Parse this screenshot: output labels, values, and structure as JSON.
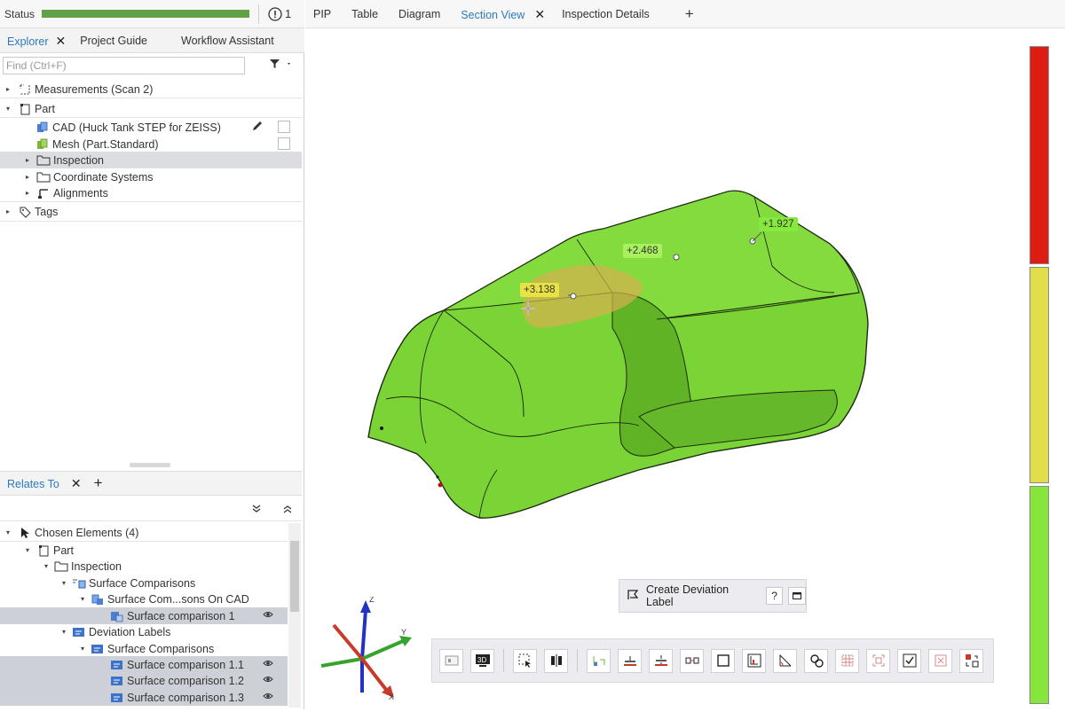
{
  "status": {
    "label": "Status",
    "progress": 1.0,
    "warning_count": "1"
  },
  "explorer": {
    "tabs": [
      {
        "label": "Explorer",
        "close": "✕"
      },
      {
        "label": "Project Guide"
      },
      {
        "label": "Workflow Assistant"
      }
    ],
    "find_placeholder": "Find (Ctrl+F)",
    "filter_icon": "filter-icon",
    "tree": [
      {
        "label": "Measurements (Scan 2)"
      },
      {
        "label": "Part"
      },
      {
        "label": "CAD (Huck Tank STEP for ZEISS)"
      },
      {
        "label": "Mesh (Part.Standard)"
      },
      {
        "label": "Inspection"
      },
      {
        "label": "Coordinate Systems"
      },
      {
        "label": "Alignments"
      },
      {
        "label": "Tags"
      }
    ]
  },
  "relates": {
    "tab_label": "Relates To",
    "close": "✕",
    "add": "+",
    "tree": [
      {
        "label": "Chosen Elements (4)"
      },
      {
        "label": "Part"
      },
      {
        "label": "Inspection"
      },
      {
        "label": "Surface Comparisons"
      },
      {
        "label": "Surface Com...sons On CAD"
      },
      {
        "label": "Surface comparison 1"
      },
      {
        "label": "Deviation Labels"
      },
      {
        "label": "Surface Comparisons"
      },
      {
        "label": "Surface comparison 1.1"
      },
      {
        "label": "Surface comparison 1.2"
      },
      {
        "label": "Surface comparison 1.3"
      }
    ]
  },
  "view_tabs": [
    {
      "label": "PIP"
    },
    {
      "label": "Table"
    },
    {
      "label": "Diagram"
    },
    {
      "label": "Section View",
      "close": "✕"
    },
    {
      "label": "Inspection Details"
    },
    {
      "label": "+"
    }
  ],
  "deviation_labels": [
    "+3.138",
    "+2.468",
    "+1.927"
  ],
  "axes": {
    "x": "X",
    "y": "Y",
    "z": "Z"
  },
  "create_deviation_label": {
    "label": "Create Deviation Label",
    "help": "?"
  },
  "colors": {
    "part": "#7fd93a",
    "accent": "#2a7bc0",
    "scale_red": "#dd1c12",
    "scale_yellow": "#e2de4a",
    "scale_green": "#86e63b"
  },
  "toolbar_icons": [
    "view-icon",
    "3d-icon",
    "select-icon",
    "split-icon",
    "points-icon",
    "plane-icon",
    "section-icon",
    "connect-icon",
    "rect-icon",
    "chart-icon",
    "angle-icon",
    "circle-icon",
    "grid-icon",
    "frame-icon",
    "check-icon",
    "delete-icon",
    "settings-icon"
  ]
}
